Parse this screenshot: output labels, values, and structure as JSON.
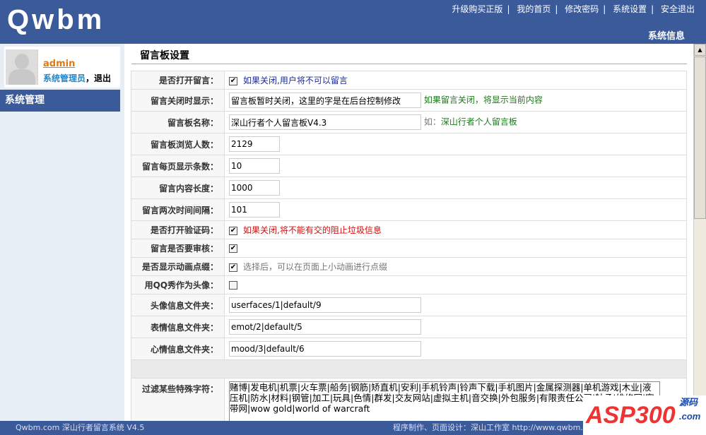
{
  "header": {
    "logo": "Qwbm",
    "nav": [
      "升级购买正版",
      "我的首页",
      "修改密码",
      "系统设置",
      "安全退出"
    ],
    "sep": "|",
    "section": "系统信息"
  },
  "sidebar": {
    "username": "admin",
    "role": "系统管理员",
    "comma": "，",
    "logout": "退出",
    "menu": "系统管理"
  },
  "main": {
    "title": "留言板设置",
    "rows": [
      {
        "label": "是否打开留言：",
        "hint": "如果关闭,用户将不可以留言"
      },
      {
        "label": "留言关闭时显示：",
        "value": "留言板暂时关闭，这里的字是在后台控制修改",
        "hint": "如果留言关闭，将显示当前内容"
      },
      {
        "label": "留言板名称：",
        "value": "深山行者个人留言板V4.3",
        "hint_prefix": "如：",
        "hint": "深山行者个人留言板"
      },
      {
        "label": "留言板浏览人数：",
        "value": "2129"
      },
      {
        "label": "留言每页显示条数：",
        "value": "10"
      },
      {
        "label": "留言内容长度：",
        "value": "1000"
      },
      {
        "label": "留言两次时间间隔：",
        "value": "101"
      },
      {
        "label": "是否打开验证码：",
        "hint": "如果关闭,将不能有交的阻止垃圾信息"
      },
      {
        "label": "留言是否要审核："
      },
      {
        "label": "是否显示动画点缀：",
        "hint": "选择后，可以在页面上小动画进行点缀"
      },
      {
        "label": "用QQ秀作为头像："
      },
      {
        "label": "头像信息文件夹：",
        "value": "userfaces/1|default/9"
      },
      {
        "label": "表情信息文件夹：",
        "value": "emot/2|default/5"
      },
      {
        "label": "心情信息文件夹：",
        "value": "mood/3|default/6"
      },
      {
        "label": "过滤某些特殊字符：",
        "value": "赌博|发电机|机票|火车票|船务|钢筋|矫直机|安利|手机铃声|铃声下载|手机图片|金属探测器|单机游戏|木业|液压机|防水|材料|钢管|加工|玩具|色情|群发|交友网站|虚拟主机|音交换|外包服务|有限责任公司|轴承|维修网|宽带网|wow gold|world of warcraft"
      }
    ],
    "checks": {
      "open": true,
      "captcha": true,
      "review": true,
      "animation": true,
      "qqshow": false
    }
  },
  "footer": {
    "left": "Qwbm.com 深山行者留言系统 V4.5",
    "right": "程序制作、页面设计：深山工作室 http://www.qwbm.com"
  },
  "watermark": {
    "text": "ASP300",
    "sub": "源码 .com"
  }
}
